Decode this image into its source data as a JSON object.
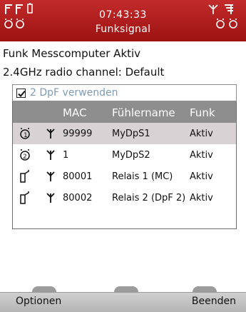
{
  "header": {
    "time": "07:43:33",
    "title": "Funksignal",
    "left_icons": [
      "probe-signal-icon",
      "probe-signal-icon",
      "battery-icon",
      "probe-icon",
      "probe-icon"
    ],
    "right_icons": [
      "antenna-icon",
      "signal-bars-icon",
      "probe-icon",
      "probe-icon"
    ],
    "bg_color": "#b01c1c"
  },
  "info": {
    "line1": "Funk Messcomputer Aktiv",
    "line2": "2.4GHz radio channel: Default"
  },
  "checkbox": {
    "label": "2 DpF verwenden",
    "checked": true
  },
  "table": {
    "headers": {
      "mac": "MAC",
      "name": "Fühlername",
      "funk": "Funk"
    },
    "rows": [
      {
        "icon": "probe-1-icon",
        "mac": "99999",
        "name": "MyDpS1",
        "funk": "Aktiv",
        "selected": true
      },
      {
        "icon": "probe-2-icon",
        "mac": "1",
        "name": "MyDpS2",
        "funk": "Aktiv",
        "selected": false
      },
      {
        "icon": "relay-icon",
        "mac": "80001",
        "name": "Relais 1 (MC)",
        "funk": "Aktiv",
        "selected": false
      },
      {
        "icon": "relay-icon",
        "mac": "80002",
        "name": "Relais 2 (DpF 2)",
        "funk": "Aktiv",
        "selected": false
      }
    ]
  },
  "softkeys": {
    "left": "Optionen",
    "right": "Beenden"
  }
}
